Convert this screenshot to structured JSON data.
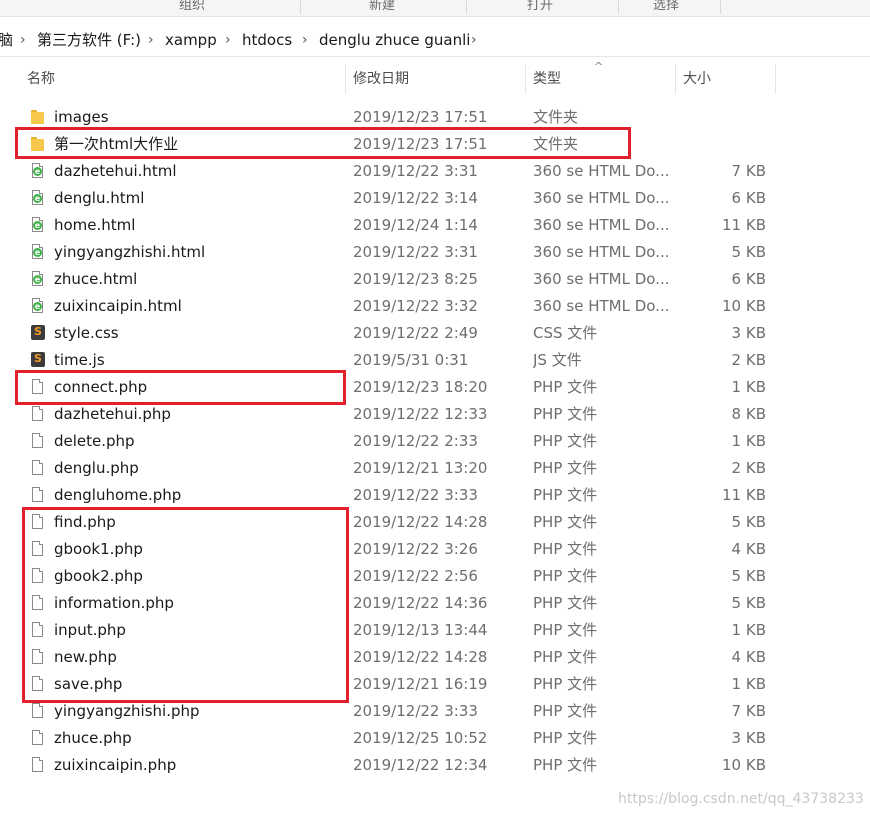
{
  "ribbon": {
    "groups": [
      "组织",
      "新建",
      "打开",
      "选择"
    ]
  },
  "address": {
    "first": "脑",
    "crumbs": [
      "第三方软件 (F:)",
      "xampp",
      "htdocs",
      "denglu zhuce guanli"
    ],
    "chevron": "›"
  },
  "columns": {
    "name": "名称",
    "date": "修改日期",
    "type": "类型",
    "size": "大小",
    "sort_indicator": "^"
  },
  "files": [
    {
      "name": "images",
      "date": "2019/12/23 17:51",
      "type": "文件夹",
      "size": "",
      "icon": "folder-icon"
    },
    {
      "name": "第一次html大作业",
      "date": "2019/12/23 17:51",
      "type": "文件夹",
      "size": "",
      "icon": "folder-icon"
    },
    {
      "name": "dazhetehui.html",
      "date": "2019/12/22 3:31",
      "type": "360 se HTML Do...",
      "size": "7 KB",
      "icon": "html-file-icon"
    },
    {
      "name": "denglu.html",
      "date": "2019/12/22 3:14",
      "type": "360 se HTML Do...",
      "size": "6 KB",
      "icon": "html-file-icon"
    },
    {
      "name": "home.html",
      "date": "2019/12/24 1:14",
      "type": "360 se HTML Do...",
      "size": "11 KB",
      "icon": "html-file-icon"
    },
    {
      "name": "yingyangzhishi.html",
      "date": "2019/12/22 3:31",
      "type": "360 se HTML Do...",
      "size": "5 KB",
      "icon": "html-file-icon"
    },
    {
      "name": "zhuce.html",
      "date": "2019/12/23 8:25",
      "type": "360 se HTML Do...",
      "size": "6 KB",
      "icon": "html-file-icon"
    },
    {
      "name": "zuixincaipin.html",
      "date": "2019/12/22 3:32",
      "type": "360 se HTML Do...",
      "size": "10 KB",
      "icon": "html-file-icon"
    },
    {
      "name": "style.css",
      "date": "2019/12/22 2:49",
      "type": "CSS 文件",
      "size": "3 KB",
      "icon": "code-file-icon"
    },
    {
      "name": "time.js",
      "date": "2019/5/31 0:31",
      "type": "JS 文件",
      "size": "2 KB",
      "icon": "code-file-icon"
    },
    {
      "name": "connect.php",
      "date": "2019/12/23 18:20",
      "type": "PHP 文件",
      "size": "1 KB",
      "icon": "file-icon"
    },
    {
      "name": "dazhetehui.php",
      "date": "2019/12/22 12:33",
      "type": "PHP 文件",
      "size": "8 KB",
      "icon": "file-icon"
    },
    {
      "name": "delete.php",
      "date": "2019/12/22 2:33",
      "type": "PHP 文件",
      "size": "1 KB",
      "icon": "file-icon"
    },
    {
      "name": "denglu.php",
      "date": "2019/12/21 13:20",
      "type": "PHP 文件",
      "size": "2 KB",
      "icon": "file-icon"
    },
    {
      "name": "dengluhome.php",
      "date": "2019/12/22 3:33",
      "type": "PHP 文件",
      "size": "11 KB",
      "icon": "file-icon"
    },
    {
      "name": "find.php",
      "date": "2019/12/22 14:28",
      "type": "PHP 文件",
      "size": "5 KB",
      "icon": "file-icon"
    },
    {
      "name": "gbook1.php",
      "date": "2019/12/22 3:26",
      "type": "PHP 文件",
      "size": "4 KB",
      "icon": "file-icon"
    },
    {
      "name": "gbook2.php",
      "date": "2019/12/22 2:56",
      "type": "PHP 文件",
      "size": "5 KB",
      "icon": "file-icon"
    },
    {
      "name": "information.php",
      "date": "2019/12/22 14:36",
      "type": "PHP 文件",
      "size": "5 KB",
      "icon": "file-icon"
    },
    {
      "name": "input.php",
      "date": "2019/12/13 13:44",
      "type": "PHP 文件",
      "size": "1 KB",
      "icon": "file-icon"
    },
    {
      "name": "new.php",
      "date": "2019/12/22 14:28",
      "type": "PHP 文件",
      "size": "4 KB",
      "icon": "file-icon"
    },
    {
      "name": "save.php",
      "date": "2019/12/21 16:19",
      "type": "PHP 文件",
      "size": "1 KB",
      "icon": "file-icon"
    },
    {
      "name": "yingyangzhishi.php",
      "date": "2019/12/22 3:33",
      "type": "PHP 文件",
      "size": "7 KB",
      "icon": "file-icon"
    },
    {
      "name": "zhuce.php",
      "date": "2019/12/25 10:52",
      "type": "PHP 文件",
      "size": "3 KB",
      "icon": "file-icon"
    },
    {
      "name": "zuixincaipin.php",
      "date": "2019/12/22 12:34",
      "type": "PHP 文件",
      "size": "10 KB",
      "icon": "file-icon"
    }
  ],
  "watermark": "https://blog.csdn.net/qq_43738233",
  "colors": {
    "highlight": "#e0202a",
    "folder": "#f5c84c",
    "html_badge": "#3fb34a"
  }
}
